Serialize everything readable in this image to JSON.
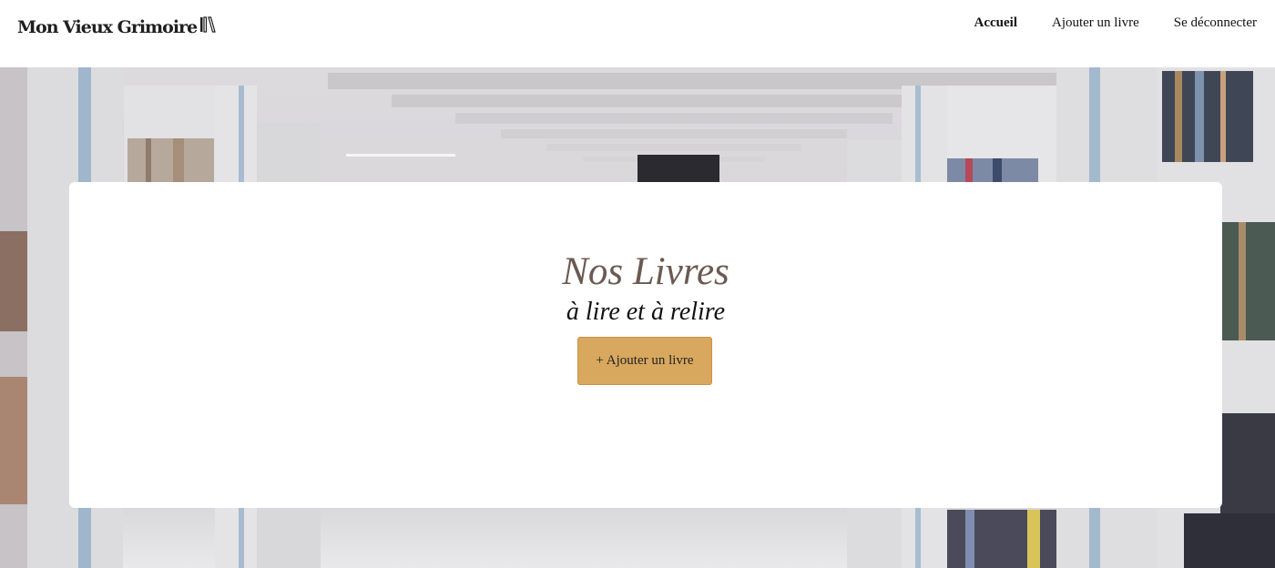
{
  "header": {
    "logo_text": "Mon Vieux Grimoire",
    "logo_icon": "books-icon",
    "nav": {
      "home": "Accueil",
      "add_book": "Ajouter un livre",
      "logout": "Se déconnecter"
    }
  },
  "hero": {
    "title": "Nos Livres",
    "subtitle": "à lire et à relire",
    "add_button": "+ Ajouter un livre"
  },
  "colors": {
    "title": "#6b5a52",
    "button": "#d8a85e",
    "background": "#e6e4e6"
  }
}
